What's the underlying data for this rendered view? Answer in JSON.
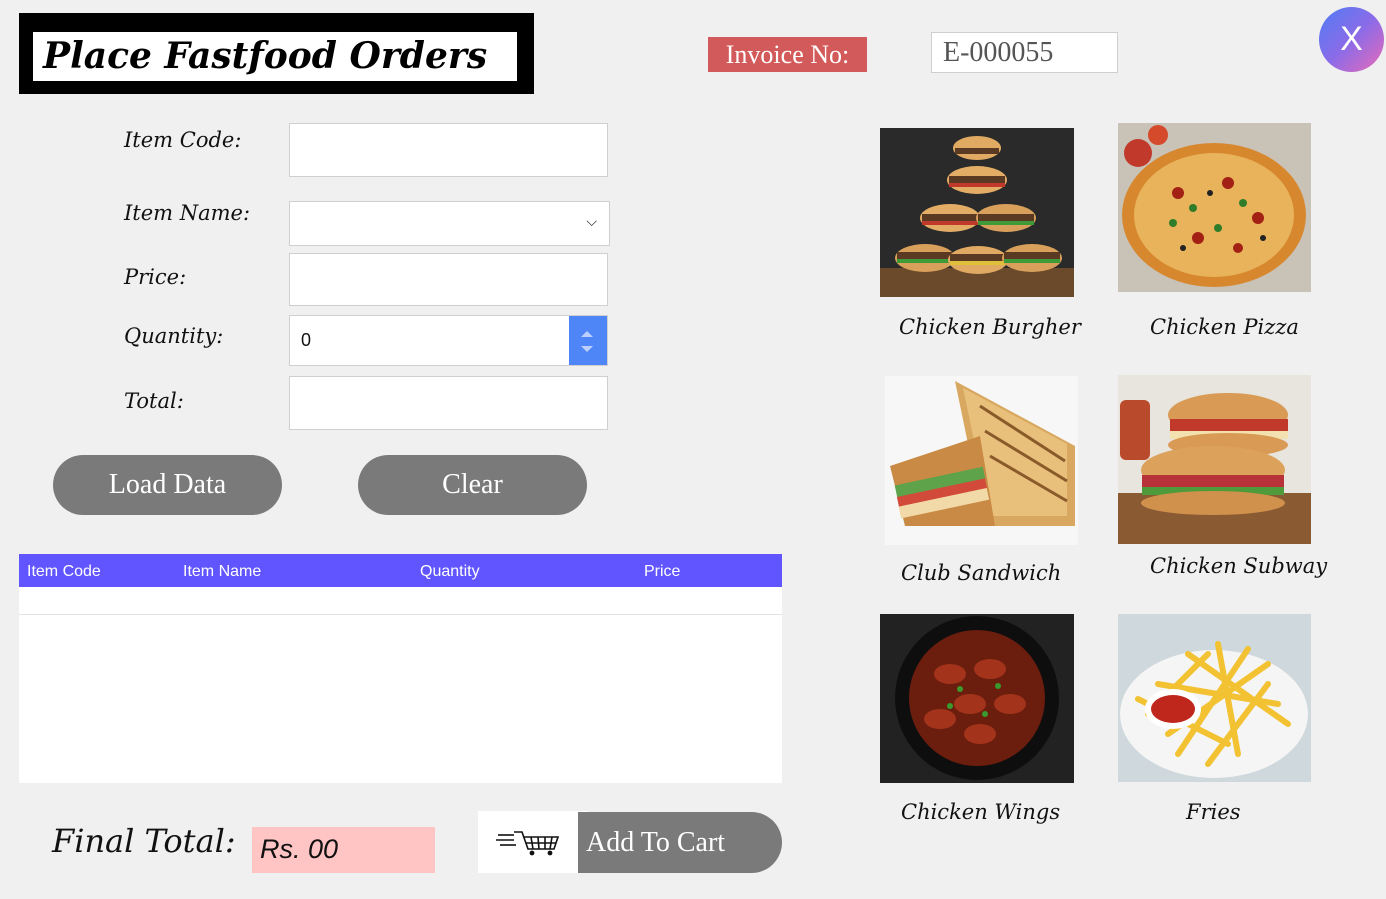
{
  "header": {
    "title": "Place Fastfood Orders",
    "invoice_label": "Invoice No:",
    "invoice_value": "E-000055",
    "close_glyph": "X"
  },
  "form": {
    "item_code_label": "Item Code:",
    "item_name_label": "Item Name:",
    "price_label": "Price:",
    "quantity_label": "Quantity:",
    "quantity_value": "0",
    "total_label": "Total:"
  },
  "buttons": {
    "load": "Load Data",
    "clear": "Clear",
    "add_to_cart": "Add To Cart"
  },
  "table": {
    "columns": [
      "Item Code",
      "Item Name",
      "Quantity",
      "Price"
    ]
  },
  "footer": {
    "final_total_label": "Final Total:",
    "final_total_value": "Rs. 00"
  },
  "menu": [
    {
      "label": "Chicken Burgher",
      "icon": "burger-image"
    },
    {
      "label": "Chicken Pizza",
      "icon": "pizza-image"
    },
    {
      "label": "Club Sandwich",
      "icon": "sandwich-image"
    },
    {
      "label": "Chicken Subway",
      "icon": "subway-image"
    },
    {
      "label": "Chicken Wings",
      "icon": "wings-image"
    },
    {
      "label": "Fries",
      "icon": "fries-image"
    }
  ],
  "colors": {
    "table_header": "#6155ff",
    "invoice_label_bg": "#d35a5a",
    "final_total_bg": "#ffc4c4",
    "button_bg": "#7a7a7a",
    "spinner_bg": "#4f86f7"
  }
}
